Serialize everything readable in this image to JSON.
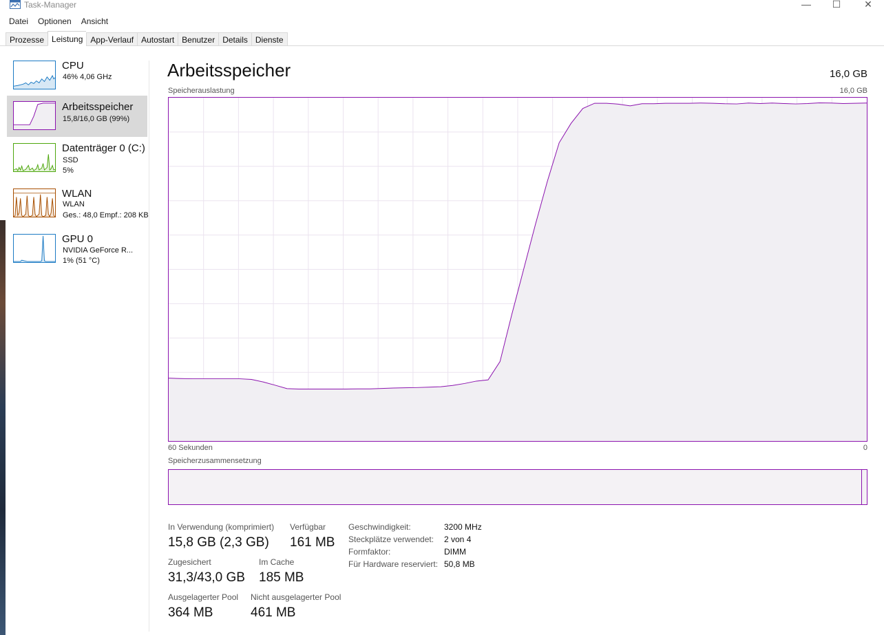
{
  "window": {
    "title": "Task-Manager",
    "icon": "task-manager-icon",
    "controls": [
      "minimize-icon",
      "maximize-icon",
      "close-icon"
    ]
  },
  "menu": [
    "Datei",
    "Optionen",
    "Ansicht"
  ],
  "tabs": [
    {
      "label": "Prozesse",
      "active": false
    },
    {
      "label": "Leistung",
      "active": true
    },
    {
      "label": "App-Verlauf",
      "active": false
    },
    {
      "label": "Autostart",
      "active": false
    },
    {
      "label": "Benutzer",
      "active": false
    },
    {
      "label": "Details",
      "active": false
    },
    {
      "label": "Dienste",
      "active": false
    }
  ],
  "sidebar": {
    "items": [
      {
        "title": "CPU",
        "sub1": "46% 4,06 GHz",
        "sub2": "",
        "color": "#1b7ac4",
        "selected": false
      },
      {
        "title": "Arbeitsspeicher",
        "sub1": "15,8/16,0 GB (99%)",
        "sub2": "",
        "color": "#8b12ae",
        "selected": true
      },
      {
        "title": "Datenträger 0 (C:)",
        "sub1": "SSD",
        "sub2": "5%",
        "color": "#4da60c",
        "selected": false
      },
      {
        "title": "WLAN",
        "sub1": "WLAN",
        "sub2": "Ges.: 48,0  Empf.: 208 KB",
        "color": "#a74f01",
        "selected": false
      },
      {
        "title": "GPU 0",
        "sub1": "NVIDIA GeForce R...",
        "sub2": "1% (51 °C)",
        "color": "#1b7ac4",
        "selected": false
      }
    ]
  },
  "main": {
    "title": "Arbeitsspeicher",
    "total": "16,0 GB",
    "graph_label": "Speicherauslastung",
    "graph_max": "16,0 GB",
    "x_left": "60 Sekunden",
    "x_right": "0",
    "composition_label": "Speicherzusammensetzung"
  },
  "stats": {
    "in_use_label": "In Verwendung (komprimiert)",
    "in_use_value": "15,8 GB (2,3 GB)",
    "available_label": "Verfügbar",
    "available_value": "161 MB",
    "committed_label": "Zugesichert",
    "committed_value": "31,3/43,0 GB",
    "cached_label": "Im Cache",
    "cached_value": "185 MB",
    "paged_label": "Ausgelagerter Pool",
    "paged_value": "364 MB",
    "nonpaged_label": "Nicht ausgelagerter Pool",
    "nonpaged_value": "461 MB"
  },
  "specs": [
    {
      "label": "Geschwindigkeit:",
      "value": "3200 MHz"
    },
    {
      "label": "Steckplätze verwendet:",
      "value": "2 von 4"
    },
    {
      "label": "Formfaktor:",
      "value": "DIMM"
    },
    {
      "label": "Für Hardware reserviert:",
      "value": "50,8 MB"
    }
  ],
  "colors": {
    "memory": "#8b12ae",
    "memory_fill": "#f1eff3",
    "grid": "#ebe3ef"
  },
  "chart_data": {
    "type": "area",
    "series": [
      {
        "values": [
          2.93,
          2.91,
          2.9,
          2.9,
          2.9,
          2.9,
          2.9,
          2.87,
          2.75,
          2.6,
          2.44,
          2.42,
          2.42,
          2.42,
          2.42,
          2.42,
          2.43,
          2.43,
          2.45,
          2.47,
          2.48,
          2.49,
          2.51,
          2.53,
          2.59,
          2.68,
          2.79,
          2.85,
          3.7,
          5.9,
          8.0,
          10.1,
          12.1,
          13.9,
          14.8,
          15.5,
          15.74,
          15.74,
          15.7,
          15.62,
          15.72,
          15.72,
          15.74,
          15.74,
          15.74,
          15.75,
          15.74,
          15.72,
          15.71,
          15.75,
          15.73,
          15.75,
          15.73,
          15.71,
          15.73,
          15.76,
          15.75,
          15.73,
          15.74,
          15.75
        ]
      }
    ],
    "ylim": [
      0,
      16
    ],
    "xlim": [
      60,
      0
    ]
  }
}
